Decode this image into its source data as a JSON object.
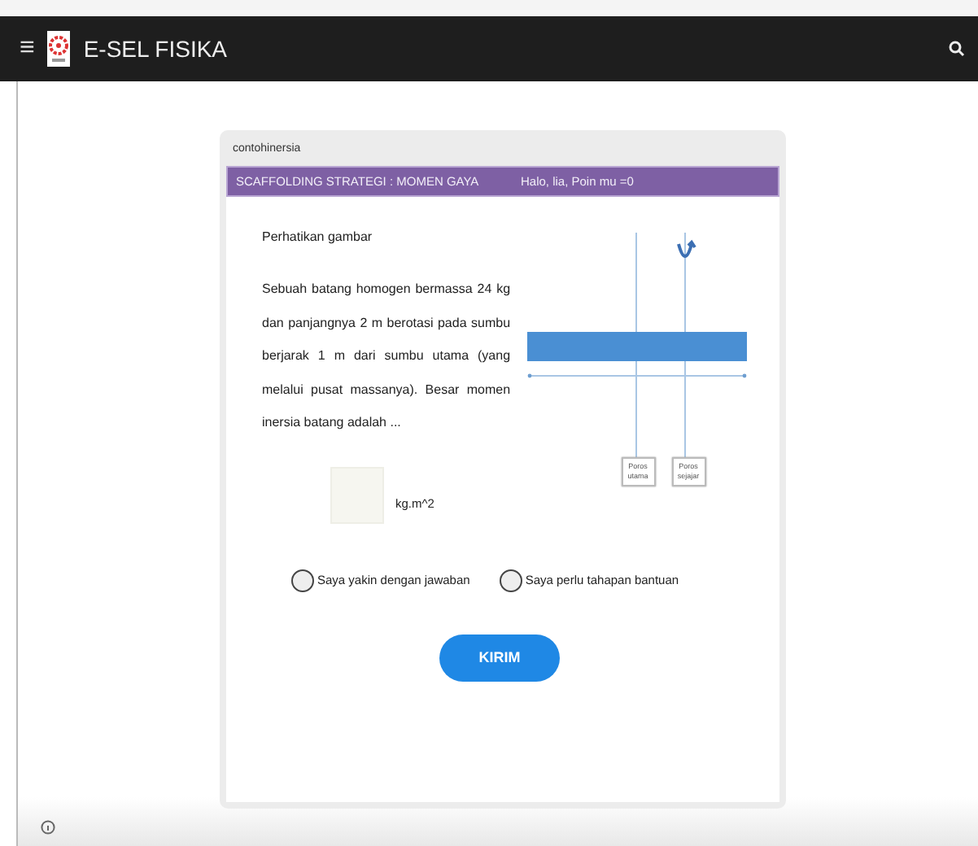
{
  "app_bar": {
    "menu_icon": "≡",
    "title": "E-SEL FISIKA"
  },
  "card": {
    "caption": "contohinersia",
    "header_title": "SCAFFOLDING STRATEGI : MOMEN GAYA",
    "greeting": "Halo, lia, Poin mu =0",
    "instruction": "Perhatikan gambar",
    "question": "Sebuah batang homogen bermassa 24 kg dan panjangnya 2 m berotasi pada sumbu berjarak 1 m dari sumbu utama (yang melalui pusat massanya). Besar momen inersia batang adalah ...",
    "answer": {
      "unit": "kg.m^2"
    },
    "diagram_labels": [
      "Poros utama",
      "Poros sejajar"
    ],
    "options": [
      {
        "label": "Saya yakin dengan jawaban",
        "selected": false
      },
      {
        "label": "Saya perlu tahapan bantuan",
        "selected": false
      }
    ],
    "submit": "KIRIM"
  }
}
